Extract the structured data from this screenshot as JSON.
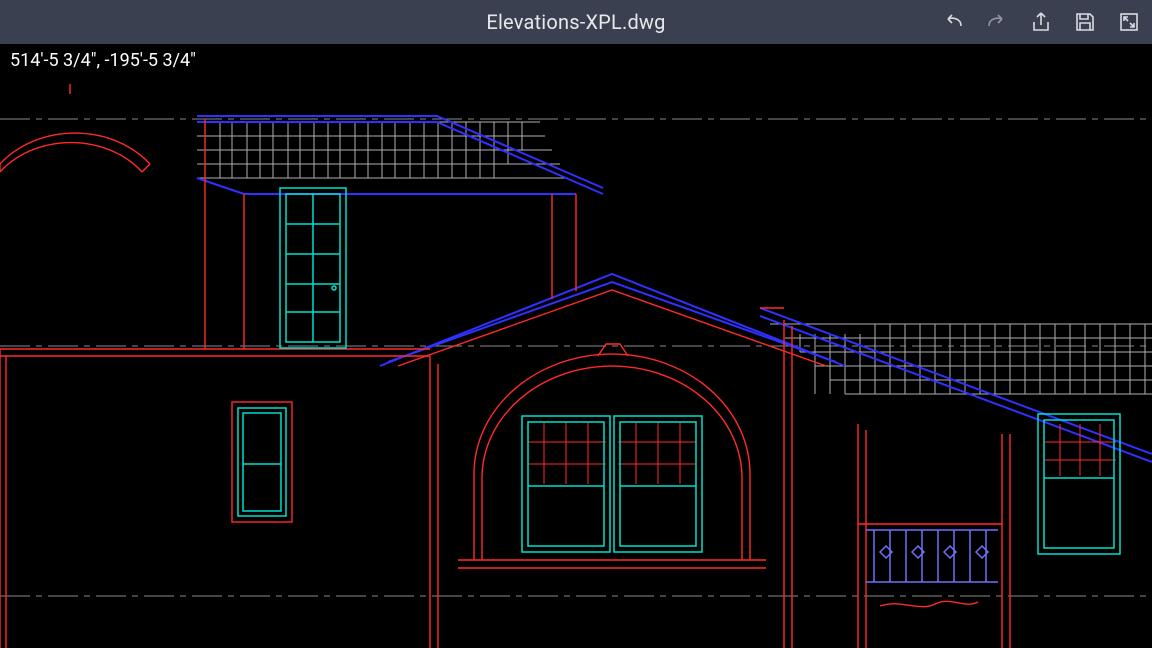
{
  "titlebar": {
    "filename": "Elevations-XPL.dwg"
  },
  "coordinates": "514'-5 3/4\",  -195'-5 3/4\"",
  "layer_colors": {
    "walls": "#ff2a2a",
    "windows": "#00e0d0",
    "roof_edge": "#3030ff",
    "shingles": "#b0b0b0",
    "guide_lines": "#8a8a8a",
    "railing": "#6060ff"
  }
}
